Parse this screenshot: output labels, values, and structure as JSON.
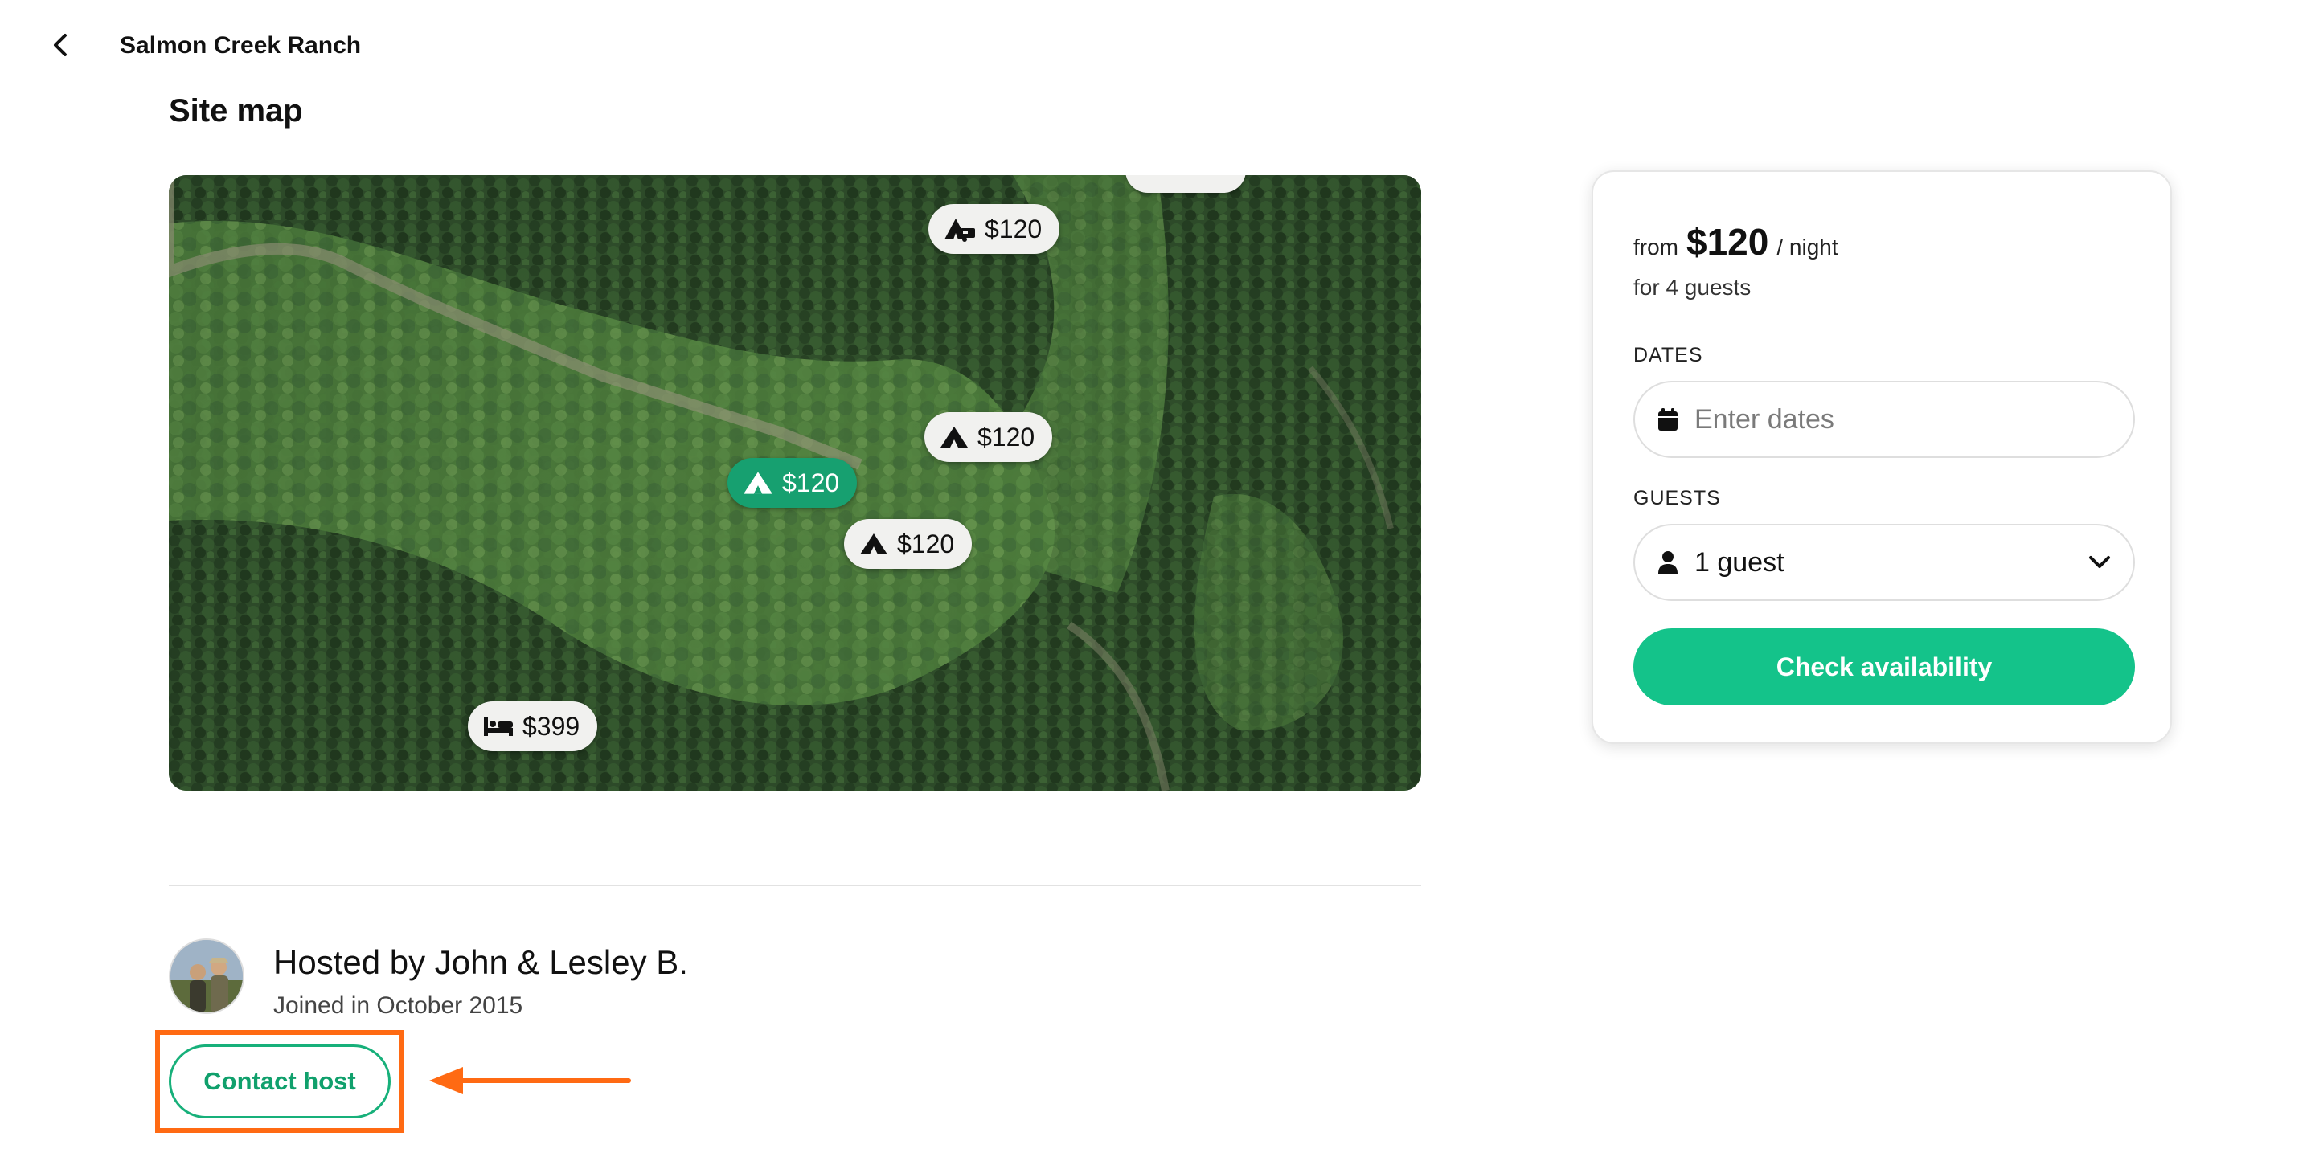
{
  "header": {
    "title": "Salmon Creek Ranch"
  },
  "section": {
    "title": "Site map"
  },
  "map": {
    "pins": [
      {
        "label": "$120",
        "kind": "rv-tent-icon",
        "active": false
      },
      {
        "label": "$120",
        "kind": "tent-icon",
        "active": false
      },
      {
        "label": "$120",
        "kind": "tent-icon",
        "active": true
      },
      {
        "label": "$120",
        "kind": "tent-icon",
        "active": false
      },
      {
        "label": "$399",
        "kind": "bed-icon",
        "active": false
      }
    ]
  },
  "host": {
    "name": "Hosted by John & Lesley B.",
    "joined": "Joined in October 2015",
    "contact_label": "Contact host"
  },
  "booking": {
    "from": "from",
    "price": "$120",
    "per": "/ night",
    "guests_note": "for 4 guests",
    "dates_label": "DATES",
    "dates_placeholder": "Enter dates",
    "guests_label": "GUESTS",
    "guests_value": "1 guest",
    "cta": "Check availability"
  },
  "colors": {
    "brand_green": "#14c38a",
    "active_pin": "#17a070",
    "annotation_orange": "#ff6a13"
  }
}
